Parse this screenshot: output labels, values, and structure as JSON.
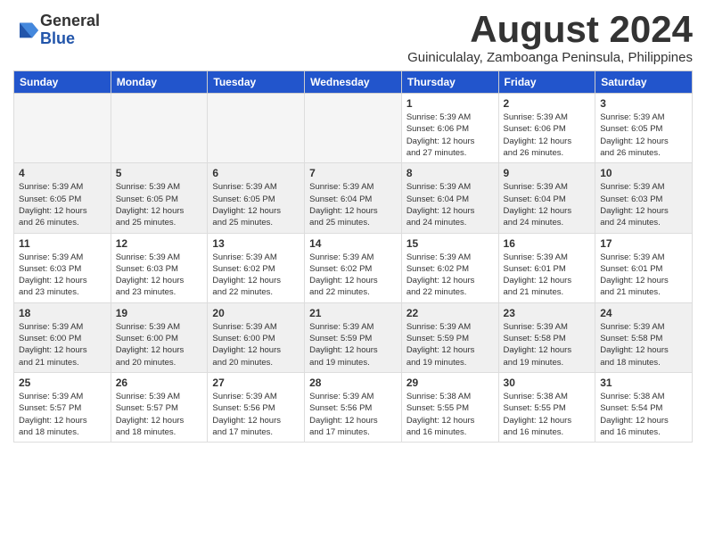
{
  "header": {
    "logo_general": "General",
    "logo_blue": "Blue",
    "title": "August 2024",
    "subtitle": "Guiniculalay, Zamboanga Peninsula, Philippines"
  },
  "calendar": {
    "weekdays": [
      "Sunday",
      "Monday",
      "Tuesday",
      "Wednesday",
      "Thursday",
      "Friday",
      "Saturday"
    ],
    "weeks": [
      {
        "shade": false,
        "days": [
          {
            "num": "",
            "detail": ""
          },
          {
            "num": "",
            "detail": ""
          },
          {
            "num": "",
            "detail": ""
          },
          {
            "num": "",
            "detail": ""
          },
          {
            "num": "1",
            "detail": "Sunrise: 5:39 AM\nSunset: 6:06 PM\nDaylight: 12 hours\nand 27 minutes."
          },
          {
            "num": "2",
            "detail": "Sunrise: 5:39 AM\nSunset: 6:06 PM\nDaylight: 12 hours\nand 26 minutes."
          },
          {
            "num": "3",
            "detail": "Sunrise: 5:39 AM\nSunset: 6:05 PM\nDaylight: 12 hours\nand 26 minutes."
          }
        ]
      },
      {
        "shade": true,
        "days": [
          {
            "num": "4",
            "detail": "Sunrise: 5:39 AM\nSunset: 6:05 PM\nDaylight: 12 hours\nand 26 minutes."
          },
          {
            "num": "5",
            "detail": "Sunrise: 5:39 AM\nSunset: 6:05 PM\nDaylight: 12 hours\nand 25 minutes."
          },
          {
            "num": "6",
            "detail": "Sunrise: 5:39 AM\nSunset: 6:05 PM\nDaylight: 12 hours\nand 25 minutes."
          },
          {
            "num": "7",
            "detail": "Sunrise: 5:39 AM\nSunset: 6:04 PM\nDaylight: 12 hours\nand 25 minutes."
          },
          {
            "num": "8",
            "detail": "Sunrise: 5:39 AM\nSunset: 6:04 PM\nDaylight: 12 hours\nand 24 minutes."
          },
          {
            "num": "9",
            "detail": "Sunrise: 5:39 AM\nSunset: 6:04 PM\nDaylight: 12 hours\nand 24 minutes."
          },
          {
            "num": "10",
            "detail": "Sunrise: 5:39 AM\nSunset: 6:03 PM\nDaylight: 12 hours\nand 24 minutes."
          }
        ]
      },
      {
        "shade": false,
        "days": [
          {
            "num": "11",
            "detail": "Sunrise: 5:39 AM\nSunset: 6:03 PM\nDaylight: 12 hours\nand 23 minutes."
          },
          {
            "num": "12",
            "detail": "Sunrise: 5:39 AM\nSunset: 6:03 PM\nDaylight: 12 hours\nand 23 minutes."
          },
          {
            "num": "13",
            "detail": "Sunrise: 5:39 AM\nSunset: 6:02 PM\nDaylight: 12 hours\nand 22 minutes."
          },
          {
            "num": "14",
            "detail": "Sunrise: 5:39 AM\nSunset: 6:02 PM\nDaylight: 12 hours\nand 22 minutes."
          },
          {
            "num": "15",
            "detail": "Sunrise: 5:39 AM\nSunset: 6:02 PM\nDaylight: 12 hours\nand 22 minutes."
          },
          {
            "num": "16",
            "detail": "Sunrise: 5:39 AM\nSunset: 6:01 PM\nDaylight: 12 hours\nand 21 minutes."
          },
          {
            "num": "17",
            "detail": "Sunrise: 5:39 AM\nSunset: 6:01 PM\nDaylight: 12 hours\nand 21 minutes."
          }
        ]
      },
      {
        "shade": true,
        "days": [
          {
            "num": "18",
            "detail": "Sunrise: 5:39 AM\nSunset: 6:00 PM\nDaylight: 12 hours\nand 21 minutes."
          },
          {
            "num": "19",
            "detail": "Sunrise: 5:39 AM\nSunset: 6:00 PM\nDaylight: 12 hours\nand 20 minutes."
          },
          {
            "num": "20",
            "detail": "Sunrise: 5:39 AM\nSunset: 6:00 PM\nDaylight: 12 hours\nand 20 minutes."
          },
          {
            "num": "21",
            "detail": "Sunrise: 5:39 AM\nSunset: 5:59 PM\nDaylight: 12 hours\nand 19 minutes."
          },
          {
            "num": "22",
            "detail": "Sunrise: 5:39 AM\nSunset: 5:59 PM\nDaylight: 12 hours\nand 19 minutes."
          },
          {
            "num": "23",
            "detail": "Sunrise: 5:39 AM\nSunset: 5:58 PM\nDaylight: 12 hours\nand 19 minutes."
          },
          {
            "num": "24",
            "detail": "Sunrise: 5:39 AM\nSunset: 5:58 PM\nDaylight: 12 hours\nand 18 minutes."
          }
        ]
      },
      {
        "shade": false,
        "days": [
          {
            "num": "25",
            "detail": "Sunrise: 5:39 AM\nSunset: 5:57 PM\nDaylight: 12 hours\nand 18 minutes."
          },
          {
            "num": "26",
            "detail": "Sunrise: 5:39 AM\nSunset: 5:57 PM\nDaylight: 12 hours\nand 18 minutes."
          },
          {
            "num": "27",
            "detail": "Sunrise: 5:39 AM\nSunset: 5:56 PM\nDaylight: 12 hours\nand 17 minutes."
          },
          {
            "num": "28",
            "detail": "Sunrise: 5:39 AM\nSunset: 5:56 PM\nDaylight: 12 hours\nand 17 minutes."
          },
          {
            "num": "29",
            "detail": "Sunrise: 5:38 AM\nSunset: 5:55 PM\nDaylight: 12 hours\nand 16 minutes."
          },
          {
            "num": "30",
            "detail": "Sunrise: 5:38 AM\nSunset: 5:55 PM\nDaylight: 12 hours\nand 16 minutes."
          },
          {
            "num": "31",
            "detail": "Sunrise: 5:38 AM\nSunset: 5:54 PM\nDaylight: 12 hours\nand 16 minutes."
          }
        ]
      }
    ]
  }
}
